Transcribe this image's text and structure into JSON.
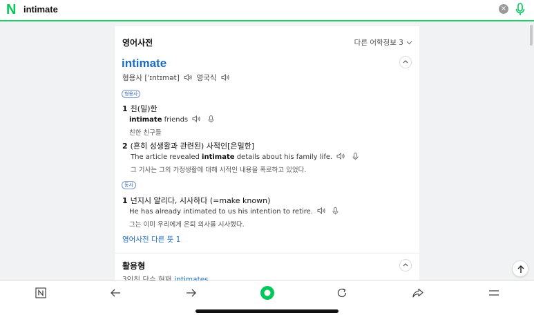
{
  "search": {
    "query": "intimate"
  },
  "colors": {
    "brand": "#03c75a",
    "link": "#1b6cc4"
  },
  "dict": {
    "section_title": "영어사전",
    "more_info": "다른 어학정보 3",
    "headword": "intimate",
    "pos_main": "형용사",
    "ipa": "[ˈɪntɪmət]",
    "region": "영국식",
    "pos_adj_badge": "형용사",
    "sense1": {
      "num": "1",
      "meaning": "친(밀)한",
      "ex_bold": "intimate",
      "ex_rest": " friends",
      "ex_ko": "친한 친구들"
    },
    "sense2": {
      "num": "2",
      "meaning": "(흔히 성생활과 관련된) 사적인[은밀한]",
      "ex_pre": "The article revealed ",
      "ex_bold": "intimate",
      "ex_post": " details about his family life.",
      "ex_ko": "그 기사는 그의 가정생활에 대해 사적인 내용을 폭로하고 있었다."
    },
    "pos_verb_badge": "동사",
    "sense3": {
      "num": "1",
      "meaning": "넌지시 알리다, 시사하다 (=make known)",
      "ex": "He has already intimated to us his intention to retire.",
      "ex_ko": "그는 이미 우리에게 은퇴 의사를 시사했다."
    },
    "more_link": "영어사전 다른 뜻 1"
  },
  "conjugation": {
    "title": "활용형",
    "label": "3인칭 단수 현재",
    "value": "intimates"
  },
  "icons": {
    "logo": "N",
    "clear": "×",
    "chevron": "⌄",
    "collapse": "︿"
  }
}
